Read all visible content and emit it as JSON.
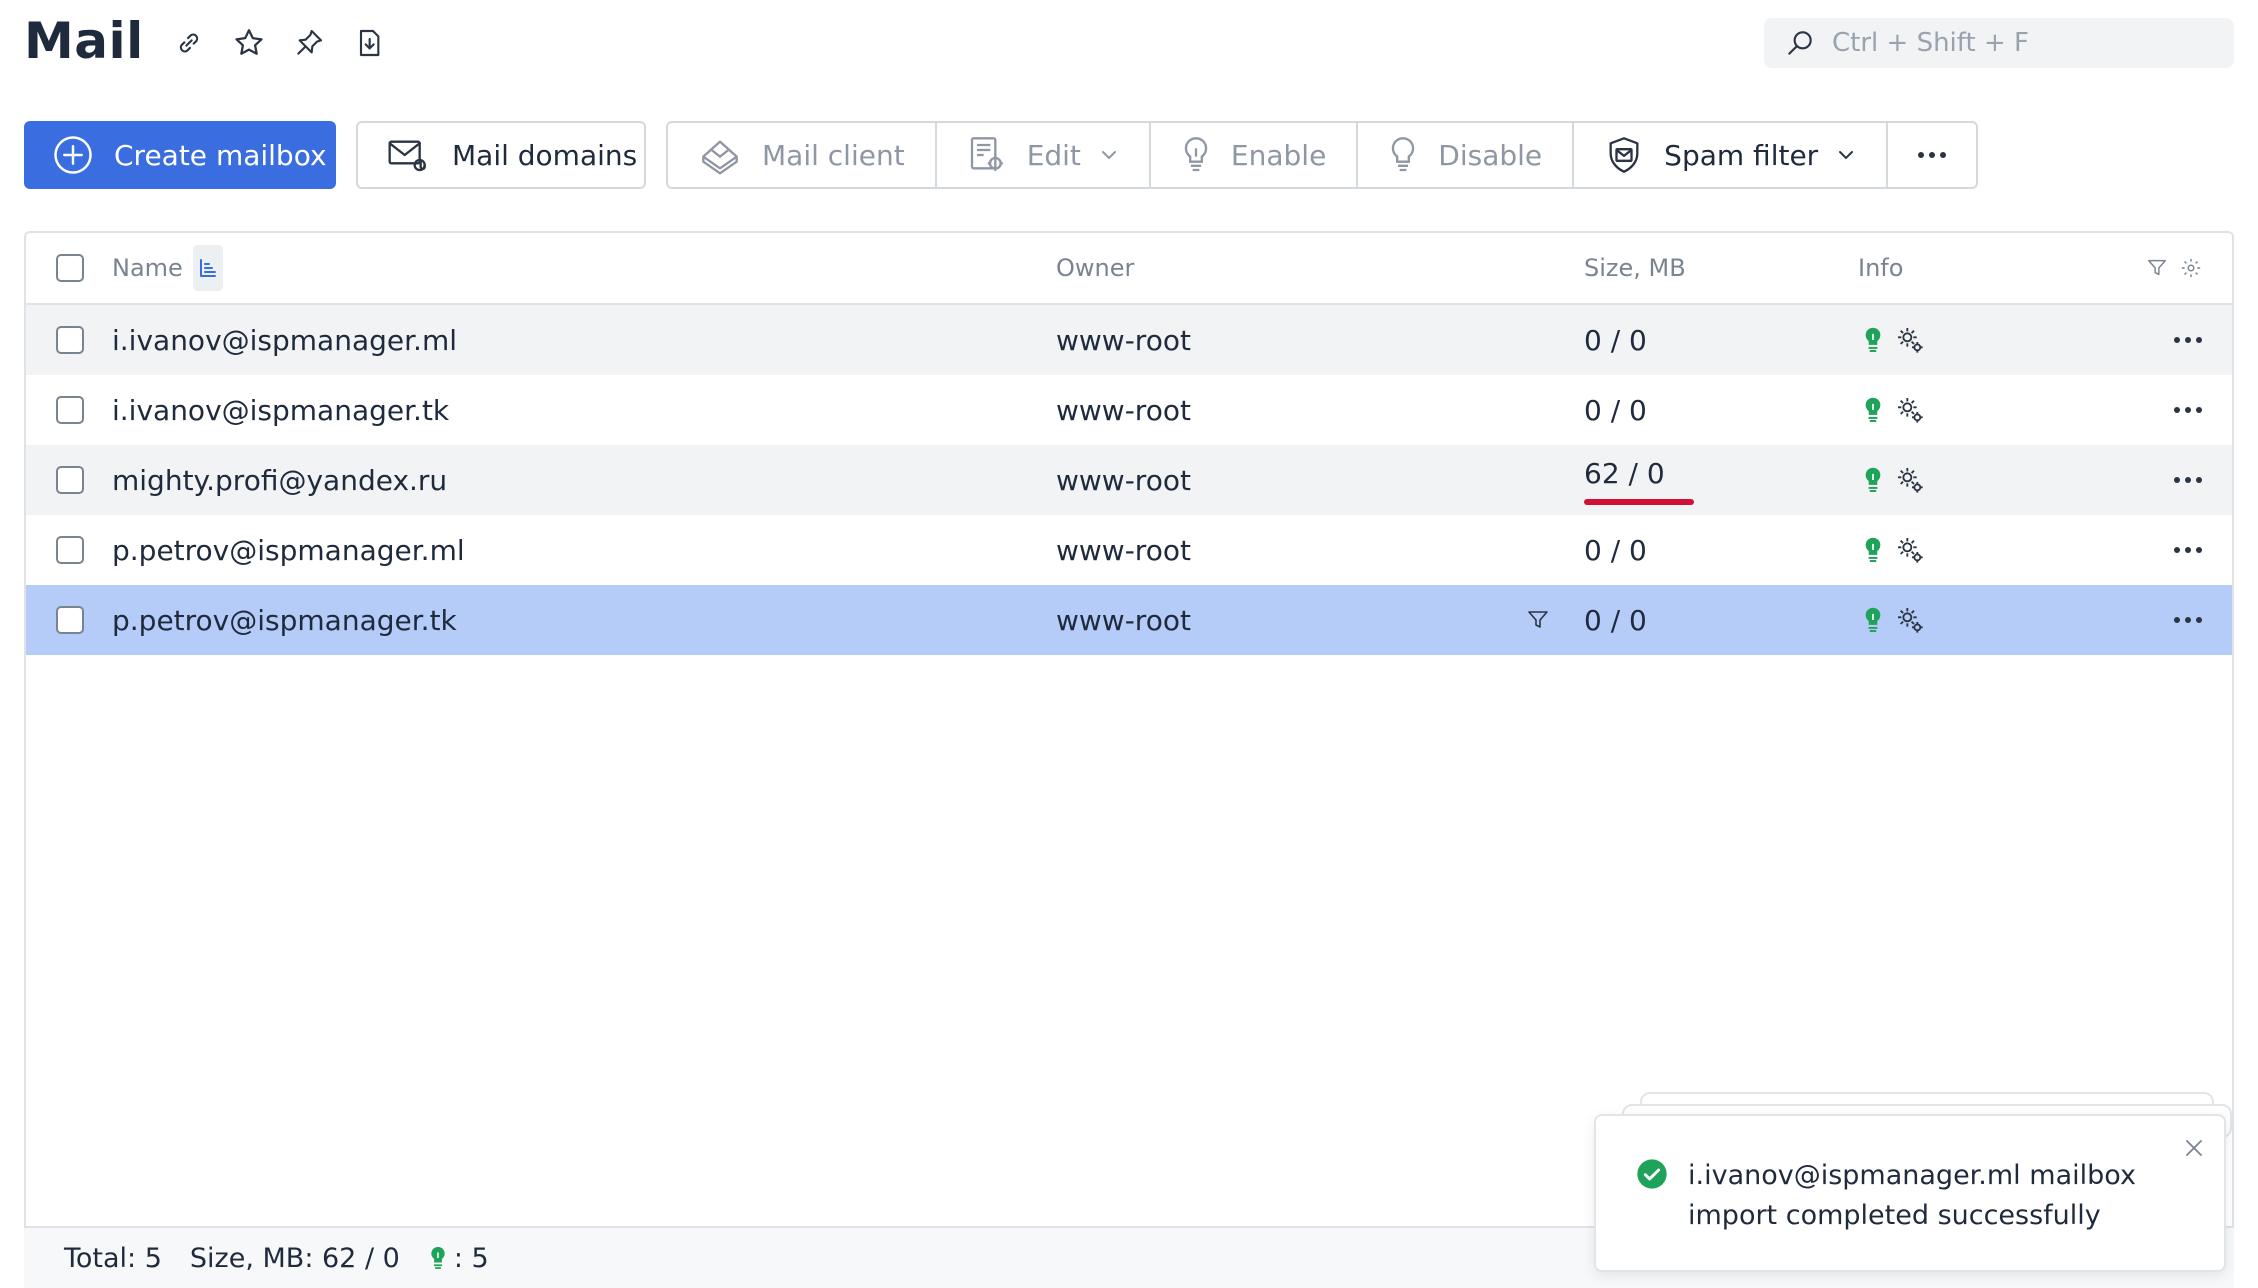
{
  "page": {
    "title": "Mail"
  },
  "title_icons": [
    "link-icon",
    "star-icon",
    "pin-icon",
    "download-icon"
  ],
  "search": {
    "placeholder": "Ctrl + Shift + F",
    "value": ""
  },
  "toolbar": {
    "create_mailbox": "Create mailbox",
    "mail_domains": "Mail domains",
    "mail_client": "Mail client",
    "edit": "Edit",
    "enable": "Enable",
    "disable": "Disable",
    "spam_filter": "Spam filter"
  },
  "table": {
    "columns": {
      "name": "Name",
      "owner": "Owner",
      "size": "Size, MB",
      "info": "Info"
    },
    "rows": [
      {
        "name": "i.ivanov@ispmanager.ml",
        "owner": "www-root",
        "size": "0 / 0",
        "enabled": true,
        "state": "hover"
      },
      {
        "name": "i.ivanov@ispmanager.tk",
        "owner": "www-root",
        "size": "0 / 0",
        "enabled": true,
        "state": "normal"
      },
      {
        "name": "mighty.profi@yandex.ru",
        "owner": "www-root",
        "size": "62 / 0",
        "enabled": true,
        "state": "normal",
        "over_quota": true
      },
      {
        "name": "p.petrov@ispmanager.ml",
        "owner": "www-root",
        "size": "0 / 0",
        "enabled": true,
        "state": "normal"
      },
      {
        "name": "p.petrov@ispmanager.tk",
        "owner": "www-root",
        "size": "0 / 0",
        "enabled": true,
        "state": "selected"
      }
    ]
  },
  "footer": {
    "total": "Total: 5",
    "size": "Size, MB: 62 / 0",
    "enabled_count": ": 5"
  },
  "toast": {
    "message": "i.ivanov@ispmanager.ml mailbox import completed successfully",
    "status": "success"
  },
  "colors": {
    "primary": "#3a6de0",
    "selected_row": "#b5cbf8",
    "alt_row": "#f2f3f4",
    "success": "#1fa35a",
    "danger": "#d01035"
  }
}
